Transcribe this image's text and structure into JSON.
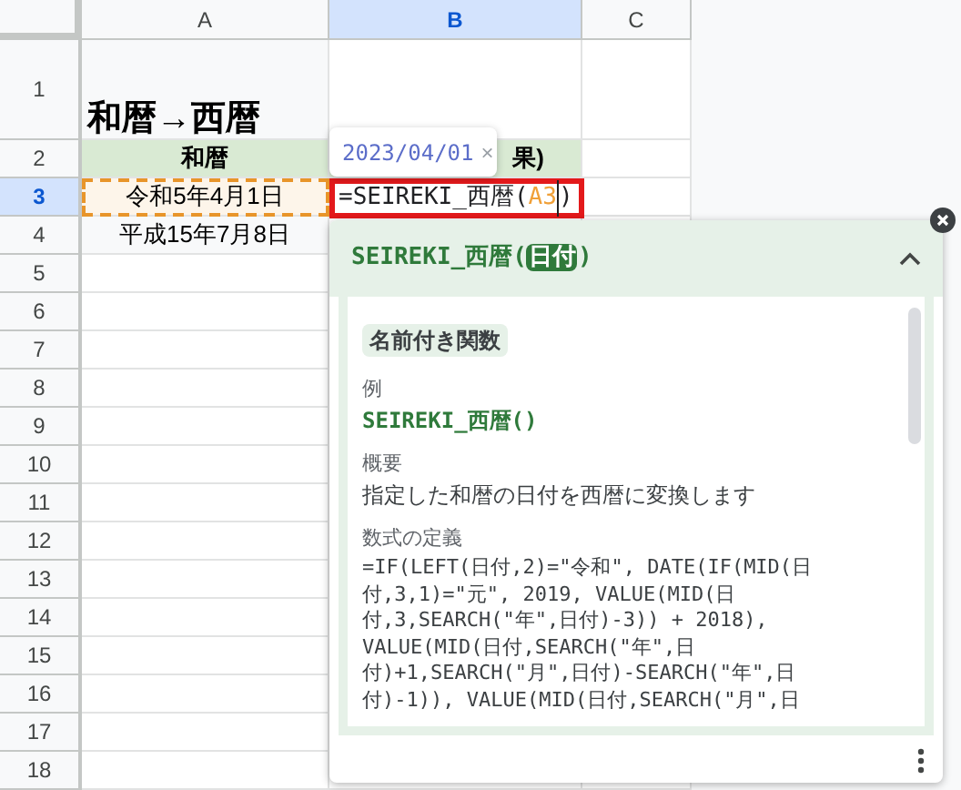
{
  "columns": [
    {
      "label": "A",
      "selected": false
    },
    {
      "label": "B",
      "selected": true
    },
    {
      "label": "C",
      "selected": false
    }
  ],
  "rows": [
    {
      "number": "1",
      "selected": false,
      "cells": {
        "A": {
          "kind": "title",
          "text": "和暦→西暦"
        }
      }
    },
    {
      "number": "2",
      "selected": false,
      "cells": {
        "A": {
          "kind": "header",
          "text": "和暦"
        },
        "B": {
          "kind": "header",
          "text": "果)"
        }
      }
    },
    {
      "number": "3",
      "selected": true,
      "cells": {
        "A": {
          "kind": "value",
          "text": "令和5年4月1日",
          "copied": true
        },
        "B": {
          "kind": "editor",
          "parts": [
            {
              "kind": "plain",
              "text": "=SEIREKI_西暦("
            },
            {
              "kind": "ref",
              "text": "A3"
            },
            {
              "kind": "plain",
              "text": ")"
            }
          ]
        }
      }
    },
    {
      "number": "4",
      "selected": false,
      "cells": {
        "A": {
          "kind": "value",
          "text": "平成15年7月8日",
          "copied": false
        }
      }
    },
    {
      "number": "5",
      "selected": false
    },
    {
      "number": "6",
      "selected": false
    },
    {
      "number": "7",
      "selected": false
    },
    {
      "number": "8",
      "selected": false
    },
    {
      "number": "9",
      "selected": false
    },
    {
      "number": "10",
      "selected": false
    },
    {
      "number": "11",
      "selected": false
    },
    {
      "number": "12",
      "selected": false
    },
    {
      "number": "13",
      "selected": false
    },
    {
      "number": "14",
      "selected": false
    },
    {
      "number": "15",
      "selected": false
    },
    {
      "number": "16",
      "selected": false
    },
    {
      "number": "17",
      "selected": false
    },
    {
      "number": "18",
      "selected": false
    }
  ],
  "value_preview": {
    "value": "2023/04/01",
    "close": "×"
  },
  "formula_help": {
    "title_parts": [
      {
        "kind": "plain",
        "text": "SEIREKI_西暦("
      },
      {
        "kind": "arg",
        "text": "日付"
      },
      {
        "kind": "plain",
        "text": ")"
      }
    ],
    "expanded": true,
    "badge": "名前付き関数",
    "sections": [
      {
        "heading": "例",
        "kind": "example",
        "lines": [
          "SEIREKI_西暦()"
        ]
      },
      {
        "heading": "概要",
        "kind": "text",
        "lines": [
          "指定した和暦の日付を西暦に変換します"
        ]
      },
      {
        "heading": "数式の定義",
        "kind": "code",
        "lines": [
          "=IF(LEFT(日付,2)=\"令和\", DATE(IF(MID(日",
          "付,3,1)=\"元\", 2019, VALUE(MID(日",
          "付,3,SEARCH(\"年\",日付)-3)) + 2018),",
          "VALUE(MID(日付,SEARCH(\"年\",日",
          "付)+1,SEARCH(\"月\",日付)-SEARCH(\"年\",日",
          "付)-1)), VALUE(MID(日付,SEARCH(\"月\",日"
        ]
      }
    ]
  }
}
